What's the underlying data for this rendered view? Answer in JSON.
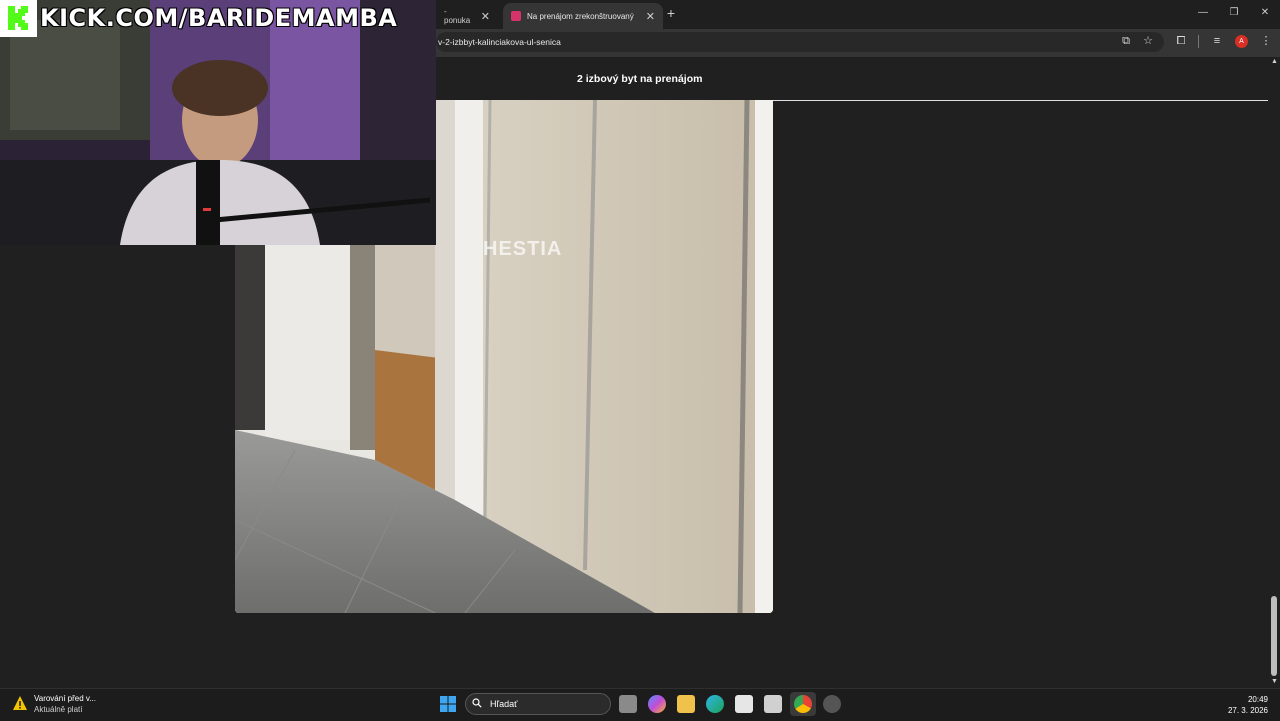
{
  "browser": {
    "tabs": [
      {
        "label": "- ponuka",
        "active": false
      },
      {
        "label": "Na prenájom zrekonštruovaný",
        "active": true
      }
    ],
    "url": "v-2-izbbyt-kalinciakova-ul-senica",
    "profile_initial": "A"
  },
  "page": {
    "title": "2 izbový byt na prenájom",
    "photo_watermark": "HESTIA"
  },
  "stream_overlay": {
    "channel_text": "KICK.COM/BARIDEMAMBA"
  },
  "taskbar": {
    "weather_title": "Varování před v...",
    "weather_subtitle": "Aktuálně platí",
    "search_placeholder": "Hľadať",
    "time": "20:49",
    "date": "27. 3. 2026"
  },
  "colors": {
    "accent_tab_favicon": "#d6336c",
    "kick_green": "#53fc18",
    "profile_avatar": "#d93025"
  },
  "icons": [
    "close-icon",
    "plus-icon",
    "minimize-icon",
    "restore-icon",
    "window-close-icon",
    "install-icon",
    "star-icon",
    "extensions-icon",
    "tab-search-icon",
    "menu-icon",
    "windows-start-icon",
    "search-icon",
    "warning-icon"
  ]
}
